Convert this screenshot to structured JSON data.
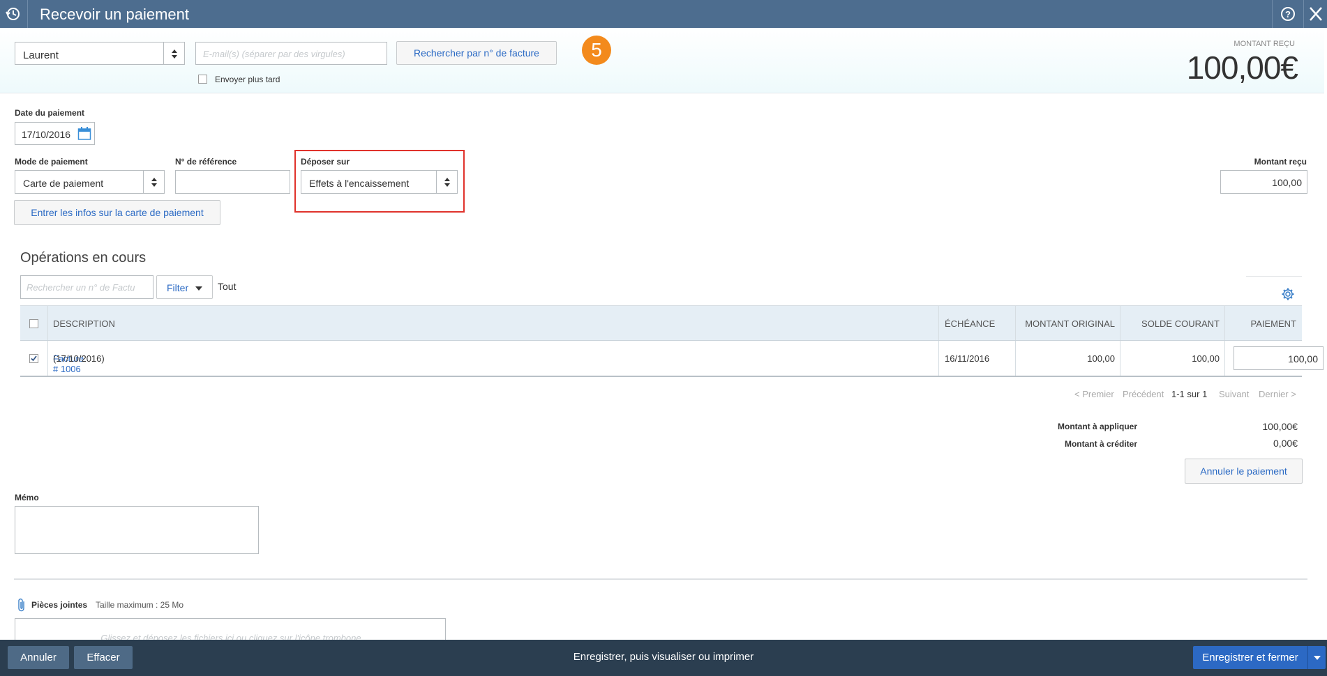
{
  "header": {
    "title": "Recevoir un paiement"
  },
  "customer": {
    "selected": "Laurent",
    "email_placeholder": "E-mail(s) (séparer par des virgules)",
    "send_later_label": "Envoyer plus tard",
    "search_invoice_label": "Rechercher par n° de facture",
    "step_number": "5"
  },
  "amount_received": {
    "label": "MONTANT REÇU",
    "value": "100,00€"
  },
  "payment": {
    "date_label": "Date du paiement",
    "date_value": "17/10/2016",
    "method_label": "Mode de paiement",
    "method_value": "Carte de paiement",
    "reference_label": "N° de référence",
    "reference_value": "",
    "deposit_label": "Déposer sur",
    "deposit_value": "Effets à l'encaissement",
    "amount_label": "Montant reçu",
    "amount_value": "100,00",
    "card_info_button": "Entrer les infos sur la carte de paiement"
  },
  "operations": {
    "title": "Opérations en cours",
    "search_placeholder": "Rechercher un n° de Factu",
    "filter_label": "Filter",
    "filter_value": "Tout",
    "columns": [
      "DESCRIPTION",
      "ÉCHÉANCE",
      "MONTANT ORIGINAL",
      "SOLDE COURANT",
      "PAIEMENT"
    ],
    "rows": [
      {
        "checked": true,
        "link": "Facture # 1006",
        "date": "(17/10/2016)",
        "due": "16/11/2016",
        "original": "100,00",
        "balance": "100,00",
        "payment": "100,00"
      }
    ],
    "pager": {
      "first": "< Premier",
      "prev": "Précédent",
      "range": "1-1 sur 1",
      "next": "Suivant",
      "last": "Dernier >"
    }
  },
  "totals": {
    "apply_label": "Montant à appliquer",
    "apply_value": "100,00€",
    "credit_label": "Montant à créditer",
    "credit_value": "0,00€",
    "cancel_payment_button": "Annuler le paiement"
  },
  "memo": {
    "label": "Mémo",
    "value": ""
  },
  "attachments": {
    "label": "Pièces jointes",
    "max_size": "Taille maximum : 25 Mo",
    "dropzone_text": "Glissez et déposez les fichiers ici ou cliquez sur l'icône trombone"
  },
  "footer": {
    "cancel": "Annuler",
    "clear": "Effacer",
    "save_view": "Enregistrer, puis visualiser ou imprimer",
    "save_close": "Enregistrer et fermer"
  },
  "colors": {
    "header_bg": "#4d6d8f",
    "footer_bg": "#2b3e50",
    "primary": "#2c69c4",
    "badge": "#f38a1c",
    "highlight": "#e0322b"
  }
}
